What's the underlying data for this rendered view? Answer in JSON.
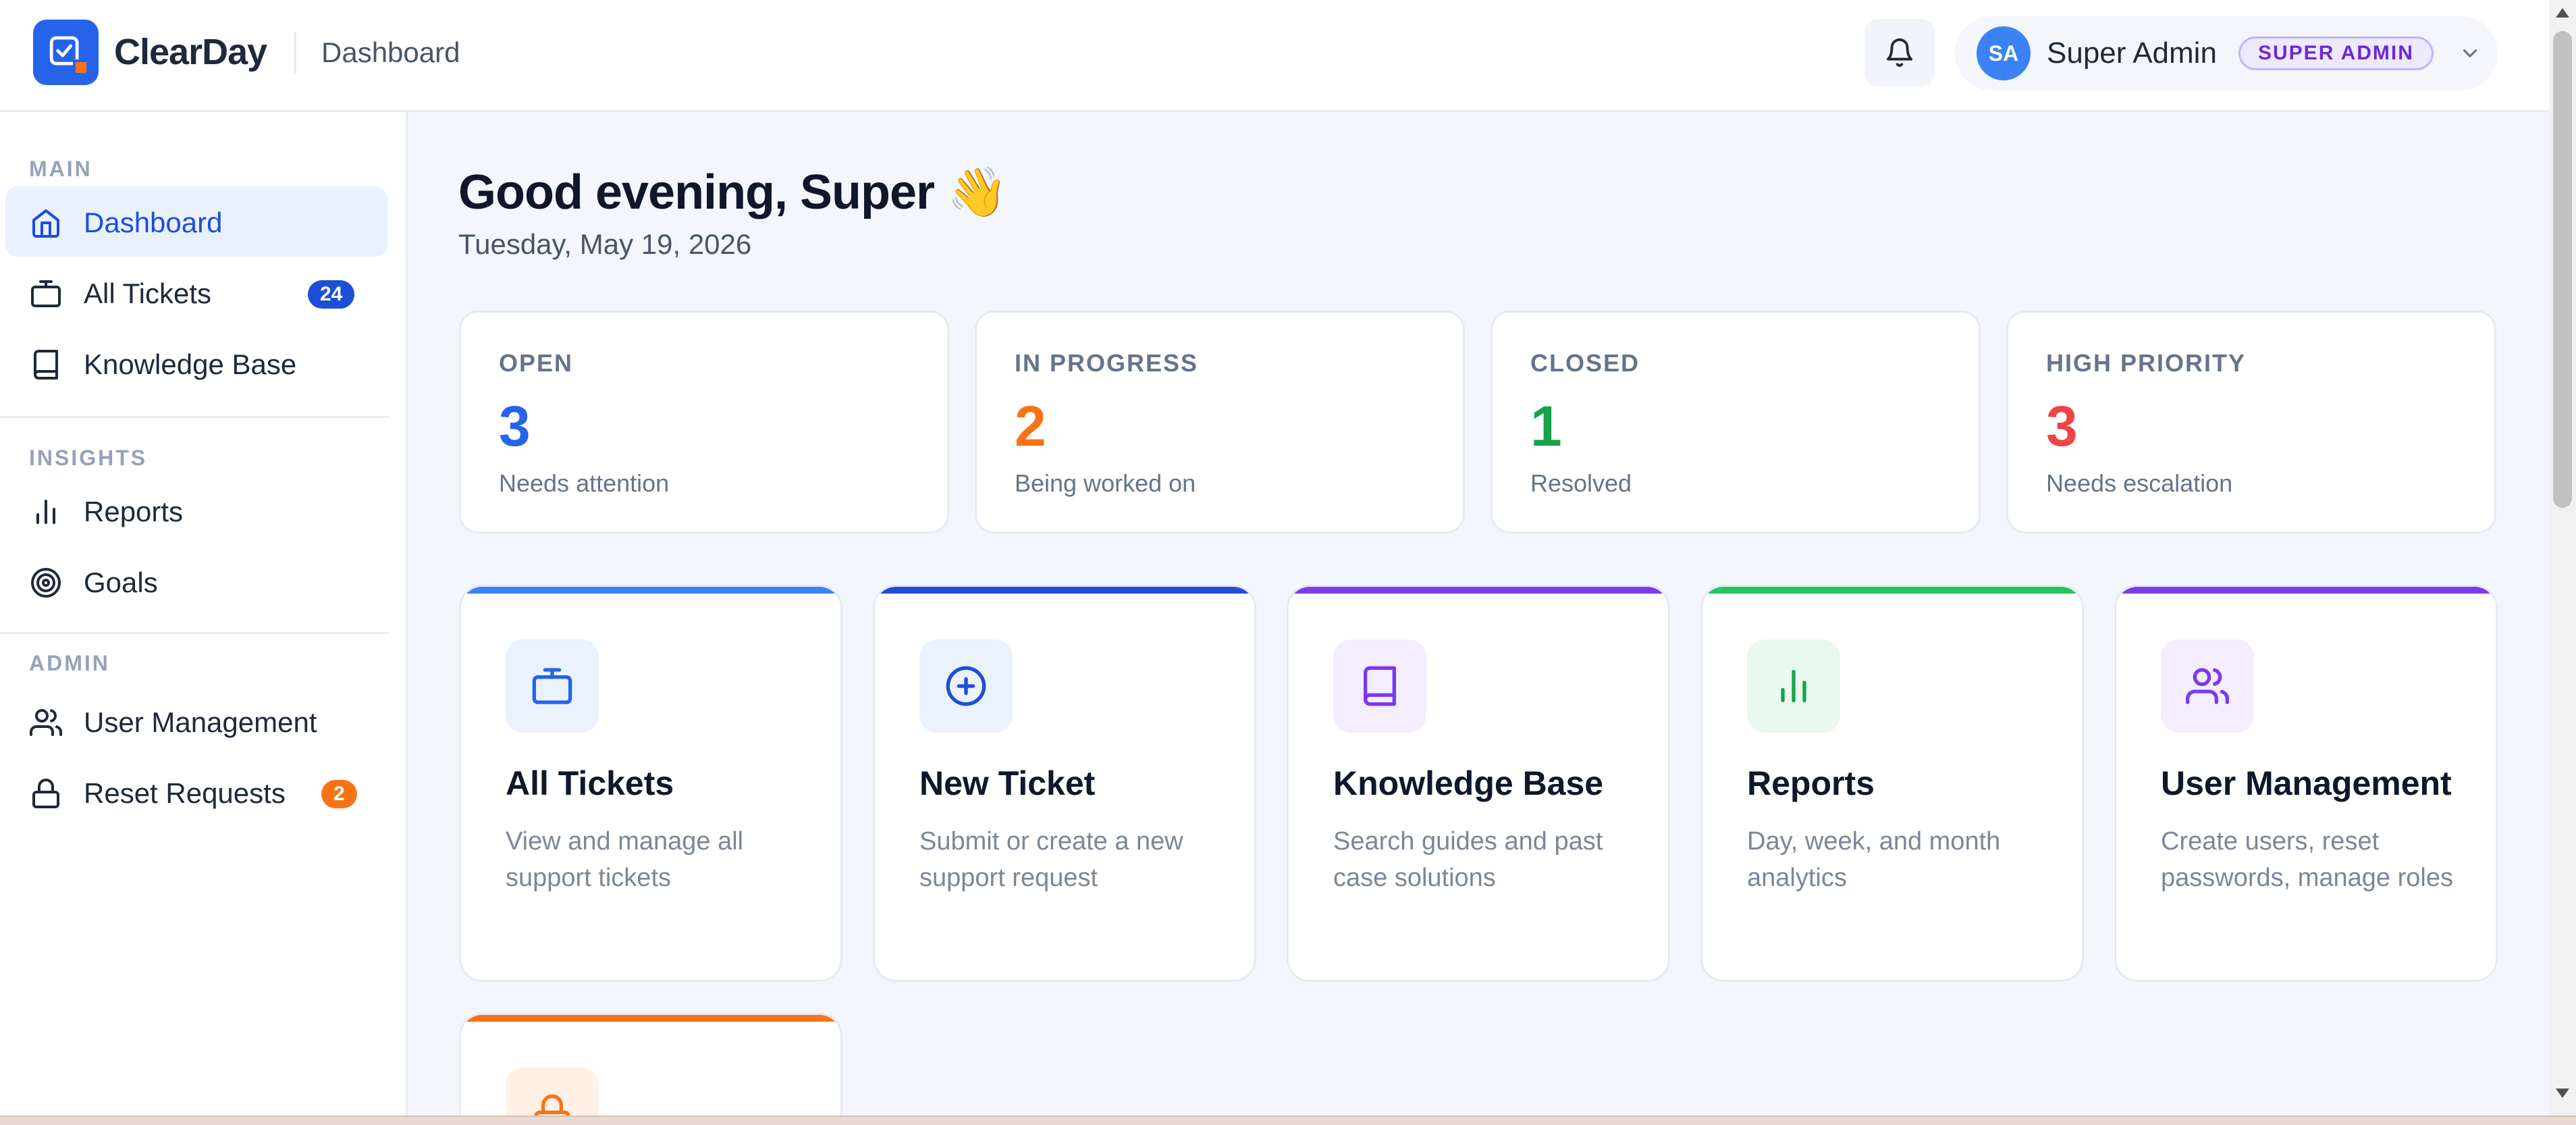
{
  "header": {
    "brand": "ClearDay",
    "page": "Dashboard",
    "user": {
      "initials": "SA",
      "name": "Super Admin",
      "role": "SUPER ADMIN"
    }
  },
  "sidebar": {
    "sections": {
      "main": "MAIN",
      "insights": "INSIGHTS",
      "admin": "ADMIN"
    },
    "items": {
      "dashboard": "Dashboard",
      "all_tickets": "All Tickets",
      "all_tickets_badge": "24",
      "knowledge_base": "Knowledge Base",
      "reports": "Reports",
      "goals": "Goals",
      "user_management": "User Management",
      "reset_requests": "Reset Requests",
      "reset_requests_badge": "2"
    }
  },
  "main": {
    "greeting": "Good evening, Super 👋",
    "date": "Tuesday, May 19, 2026",
    "stats": [
      {
        "label": "OPEN",
        "value": "3",
        "sub": "Needs attention",
        "color": "#2563eb"
      },
      {
        "label": "IN PROGRESS",
        "value": "2",
        "sub": "Being worked on",
        "color": "#f97316"
      },
      {
        "label": "CLOSED",
        "value": "1",
        "sub": "Resolved",
        "color": "#16a34a"
      },
      {
        "label": "HIGH PRIORITY",
        "value": "3",
        "sub": "Needs escalation",
        "color": "#ef4444"
      }
    ],
    "actions": [
      {
        "title": "All Tickets",
        "desc": "View and manage all support tickets",
        "accent": "#3b82f6",
        "icon": "ticket-icon"
      },
      {
        "title": "New Ticket",
        "desc": "Submit or create a new support request",
        "accent": "#1d4ed8",
        "icon": "plus-circle-icon"
      },
      {
        "title": "Knowledge Base",
        "desc": "Search guides and past case solutions",
        "accent": "#7c3aed",
        "icon": "book-icon"
      },
      {
        "title": "Reports",
        "desc": "Day, week, and month analytics",
        "accent": "#22c55e",
        "icon": "bar-chart-icon"
      },
      {
        "title": "User Management",
        "desc": "Create users, reset passwords, manage roles",
        "accent": "#7c3aed",
        "icon": "users-icon"
      },
      {
        "title": "",
        "desc": "",
        "accent": "#f97316",
        "icon": "lock-icon"
      }
    ]
  }
}
